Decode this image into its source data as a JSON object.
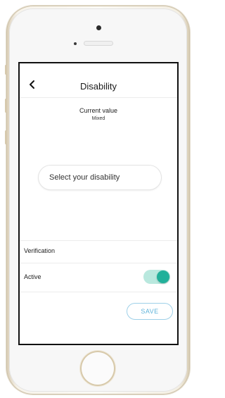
{
  "header": {
    "title": "Disability",
    "back_icon": "chevron-left-icon"
  },
  "current": {
    "label": "Current value",
    "value": "Mixed"
  },
  "select": {
    "placeholder": "Select your disability"
  },
  "verification": {
    "label": "Verification"
  },
  "active": {
    "label": "Active",
    "toggle_on": true
  },
  "actions": {
    "save_label": "SAVE"
  },
  "colors": {
    "accent_teal": "#21b09a",
    "toggle_track": "#b9e8de",
    "save_blue": "#5fb3da"
  }
}
